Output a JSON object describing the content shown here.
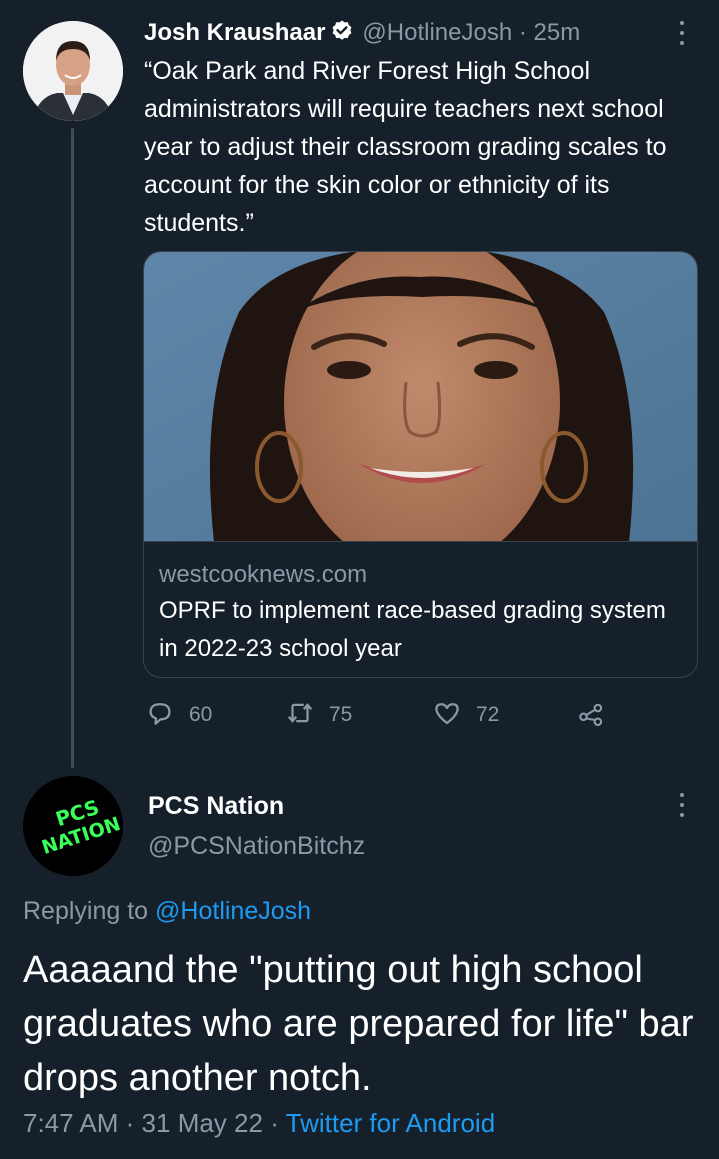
{
  "parent_tweet": {
    "display_name": "Josh Kraushaar",
    "handle": "@HotlineJosh",
    "separator": "·",
    "time": "25m",
    "text": "“Oak Park and River Forest High School administrators will require teachers next school year to adjust their classroom grading scales to account for the skin color or ethnicity of its students.”",
    "card": {
      "domain": "westcooknews.com",
      "title": "OPRF to implement race-based grading system in 2022-23 school year"
    },
    "actions": {
      "replies": "60",
      "retweets": "75",
      "likes": "72"
    }
  },
  "reply_tweet": {
    "display_name": "PCS Nation",
    "handle": "@PCSNationBitchz",
    "avatar_text_line1": "PCS",
    "avatar_text_line2": "NATION",
    "replying_prefix": "Replying to",
    "replying_handle": "@HotlineJosh",
    "text": "Aaaaand the \"putting out high school graduates who are prepared for life\" bar drops another notch.",
    "time": "7:47 AM",
    "date": "31 May 22",
    "separator": "·",
    "client": "Twitter for Android"
  },
  "colors": {
    "background": "#15202b",
    "secondary_text": "#8b98a5",
    "link": "#1d9bf0",
    "border": "#38444d",
    "verified": "#ffffff",
    "avatar_logo_green": "#39ff5a"
  },
  "icons": [
    "verified-badge-icon",
    "more-icon",
    "reply-icon",
    "retweet-icon",
    "like-icon",
    "share-icon"
  ]
}
